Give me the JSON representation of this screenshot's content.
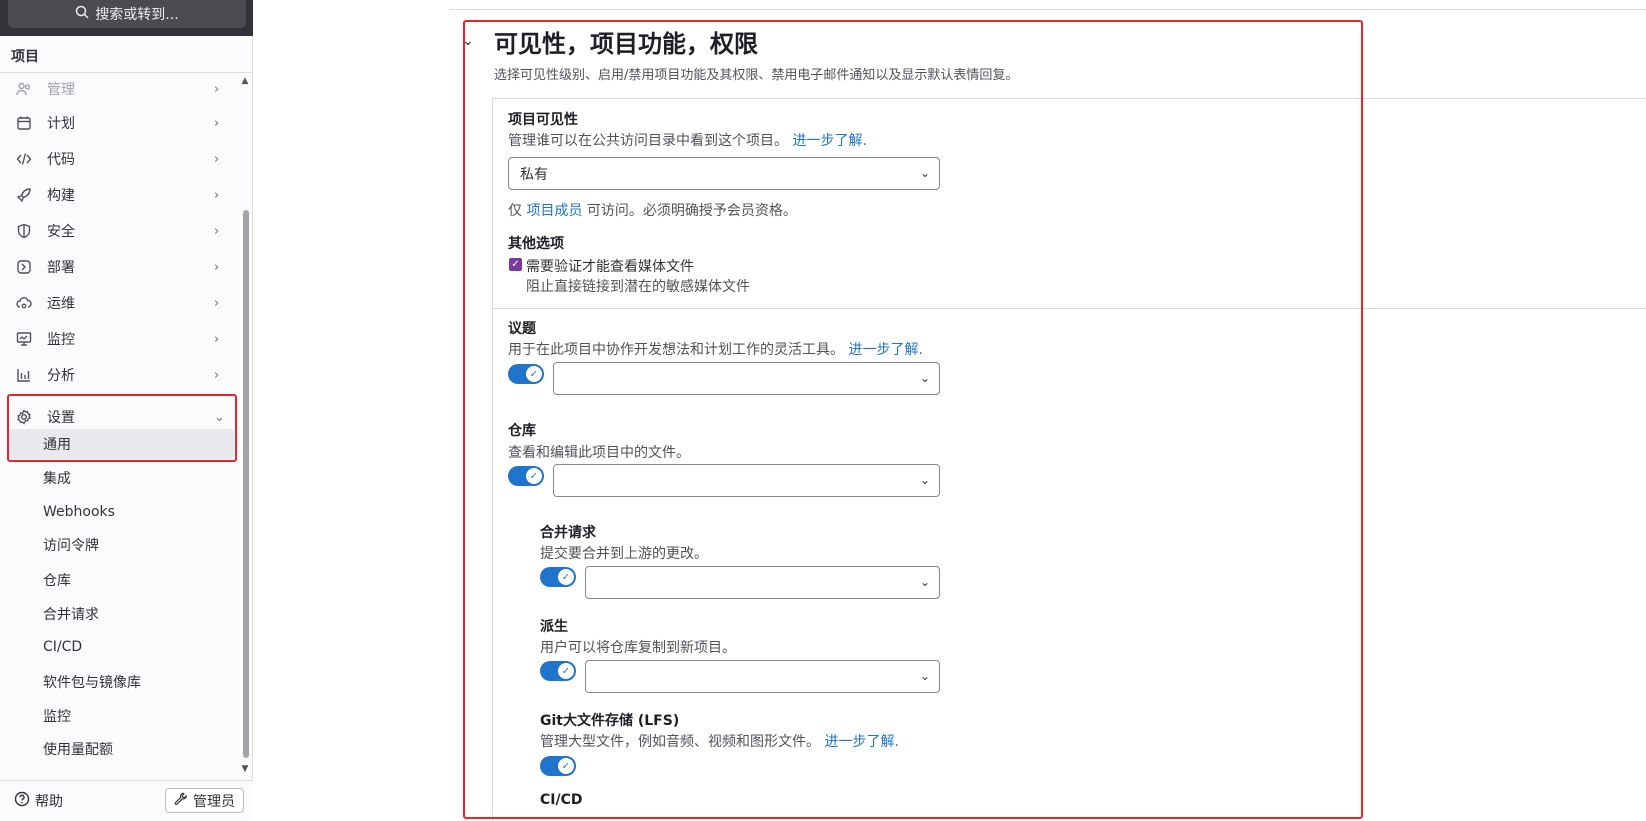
{
  "search": {
    "label": "搜索或转到..."
  },
  "context": {
    "title": "项目"
  },
  "nav": {
    "items": [
      {
        "label": "管理"
      },
      {
        "label": "计划"
      },
      {
        "label": "代码"
      },
      {
        "label": "构建"
      },
      {
        "label": "安全"
      },
      {
        "label": "部署"
      },
      {
        "label": "运维"
      },
      {
        "label": "监控"
      },
      {
        "label": "分析"
      },
      {
        "label": "设置"
      }
    ],
    "settings_sub": [
      {
        "label": "通用"
      },
      {
        "label": "集成"
      },
      {
        "label": "Webhooks"
      },
      {
        "label": "访问令牌"
      },
      {
        "label": "仓库"
      },
      {
        "label": "合并请求"
      },
      {
        "label": "CI/CD"
      },
      {
        "label": "软件包与镜像库"
      },
      {
        "label": "监控"
      },
      {
        "label": "使用量配额"
      }
    ]
  },
  "bottom": {
    "help": "帮助",
    "admin": "管理员"
  },
  "section": {
    "title": "可见性，项目功能，权限",
    "description": "选择可见性级别、启用/禁用项目功能及其权限、禁用电子邮件通知以及显示默认表情回复。"
  },
  "visibility": {
    "title": "项目可见性",
    "description": "管理谁可以在公共访问目录中看到这个项目。",
    "learn_more": "进一步了解.",
    "value": "私有",
    "note_prefix": "仅",
    "note_link": "项目成员",
    "note_suffix": "可访问。必须明确授予会员资格。"
  },
  "other": {
    "title": "其他选项",
    "checkbox_label": "需要验证才能查看媒体文件",
    "checkbox_help": "阻止直接链接到潜在的敏感媒体文件"
  },
  "issues": {
    "title": "议题",
    "description": "用于在此项目中协作开发想法和计划工作的灵活工具。",
    "learn_more": "进一步了解."
  },
  "repository": {
    "title": "仓库",
    "description": "查看和编辑此项目中的文件。"
  },
  "merge_requests": {
    "title": "合并请求",
    "description": "提交要合并到上游的更改。"
  },
  "forks": {
    "title": "派生",
    "description": "用户可以将仓库复制到新项目。"
  },
  "lfs": {
    "title": "Git大文件存储 (LFS)",
    "description": "管理大型文件，例如音频、视频和图形文件。",
    "learn_more": "进一步了解."
  },
  "cicd": {
    "title": "CI/CD"
  },
  "colors": {
    "accent": "#1f75cb",
    "highlight": "#e8262a",
    "checkbox": "#7b3aa0"
  }
}
